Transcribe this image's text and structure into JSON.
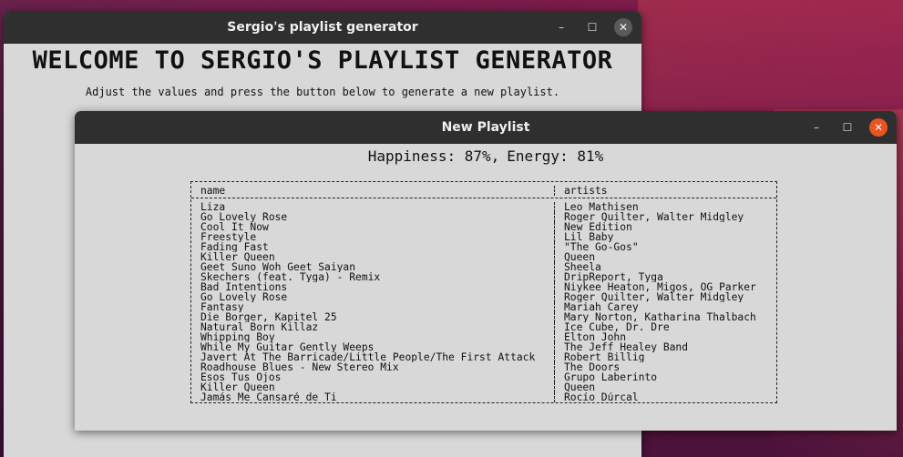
{
  "main_window": {
    "title": "Sergio's playlist generator",
    "heading": "WELCOME TO SERGIO'S PLAYLIST GENERATOR",
    "instructions": "Adjust the values and press the button below to generate a new playlist."
  },
  "playlist_window": {
    "title": "New Playlist",
    "happiness": "Happiness: 87%,",
    "energy": "Energy: 81%",
    "columns": {
      "name": "name",
      "artists": "artists"
    },
    "rows": [
      {
        "name": "Liza",
        "artists": "Leo Mathisen"
      },
      {
        "name": "Go Lovely Rose",
        "artists": "Roger Quilter, Walter Midgley"
      },
      {
        "name": "Cool It Now",
        "artists": "New Edition"
      },
      {
        "name": "Freestyle",
        "artists": "Lil Baby"
      },
      {
        "name": "Fading Fast",
        "artists": "\"The Go-Gos\""
      },
      {
        "name": "Killer Queen",
        "artists": "Queen"
      },
      {
        "name": "Geet Suno Woh Geet Saiyan",
        "artists": "Sheela"
      },
      {
        "name": "Skechers (feat. Tyga) - Remix",
        "artists": "DripReport, Tyga"
      },
      {
        "name": "Bad Intentions",
        "artists": "Niykee Heaton, Migos, OG Parker"
      },
      {
        "name": "Go Lovely Rose",
        "artists": "Roger Quilter, Walter Midgley"
      },
      {
        "name": "Fantasy",
        "artists": "Mariah Carey"
      },
      {
        "name": "Die Borger, Kapitel 25",
        "artists": "Mary Norton, Katharina Thalbach"
      },
      {
        "name": "Natural Born Killaz",
        "artists": "Ice Cube, Dr. Dre"
      },
      {
        "name": "Whipping Boy",
        "artists": "Elton John"
      },
      {
        "name": "While My Guitar Gently Weeps",
        "artists": "The Jeff Healey Band"
      },
      {
        "name": "Javert At The Barricade/Little People/The First Attack",
        "artists": "Robert Billig"
      },
      {
        "name": "Roadhouse Blues - New Stereo Mix",
        "artists": "The Doors"
      },
      {
        "name": "Esos Tus Ojos",
        "artists": "Grupo Laberinto"
      },
      {
        "name": "Killer Queen",
        "artists": "Queen"
      },
      {
        "name": "Jamás Me Cansaré de Ti",
        "artists": "Rocío Dúrcal"
      }
    ]
  },
  "window_controls": {
    "minimize": "–",
    "maximize": "☐",
    "close": "✕"
  }
}
